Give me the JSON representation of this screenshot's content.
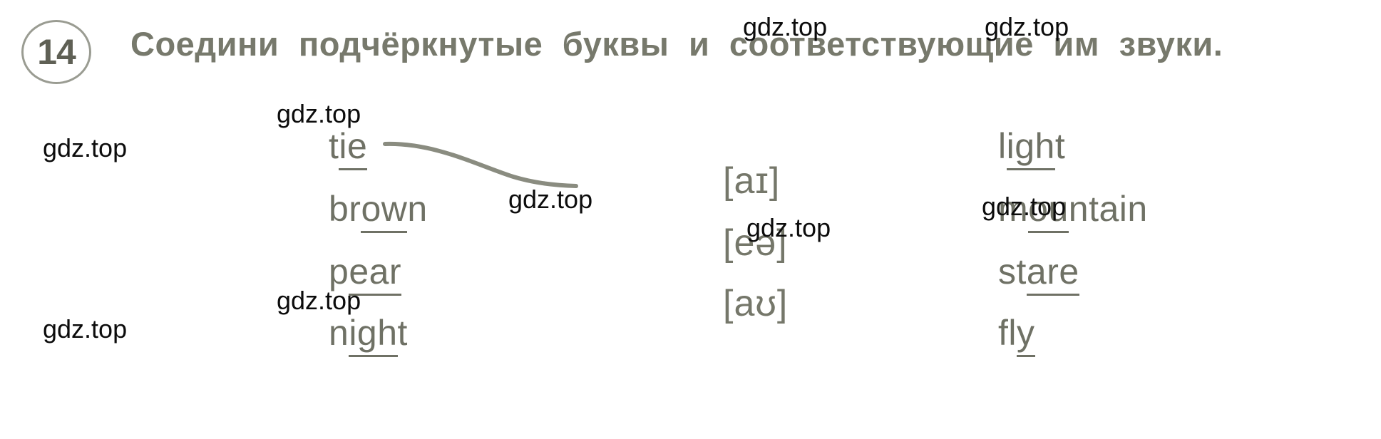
{
  "exercise": {
    "number": "14",
    "instruction": "Соедини подчёркнутые буквы и соответствующие им звуки."
  },
  "colors": {
    "text": "#6f7165",
    "heading": "#77796c",
    "badge_border": "#9a9c92",
    "connector": "#8a8c80",
    "watermark": "#0c0c0c",
    "background": "#ffffff"
  },
  "left_column": [
    {
      "prefix": "t",
      "underlined": "ie",
      "suffix": ""
    },
    {
      "prefix": "br",
      "underlined": "ow",
      "suffix": "n"
    },
    {
      "prefix": "p",
      "underlined": "ear",
      "suffix": ""
    },
    {
      "prefix": "n",
      "underlined": "igh",
      "suffix": "t"
    }
  ],
  "sounds": [
    {
      "symbol": "[aɪ]"
    },
    {
      "symbol": "[eə]"
    },
    {
      "symbol": "[aʊ]"
    }
  ],
  "right_column": [
    {
      "prefix": "l",
      "underlined": "igh",
      "suffix": "t"
    },
    {
      "prefix": "m",
      "underlined": "ou",
      "suffix": "ntain"
    },
    {
      "prefix": "st",
      "underlined": "are",
      "suffix": ""
    },
    {
      "prefix": "fl",
      "underlined": "y",
      "suffix": ""
    }
  ],
  "connection": {
    "from": "tie",
    "to": "[aɪ]"
  },
  "watermarks": [
    {
      "text": "gdz.top"
    },
    {
      "text": "gdz.top"
    },
    {
      "text": "gdz.top"
    },
    {
      "text": "gdz.top"
    },
    {
      "text": "gdz.top"
    },
    {
      "text": "gdz.top"
    },
    {
      "text": "gdz.top"
    },
    {
      "text": "gdz.top"
    },
    {
      "text": "gdz.top"
    }
  ]
}
